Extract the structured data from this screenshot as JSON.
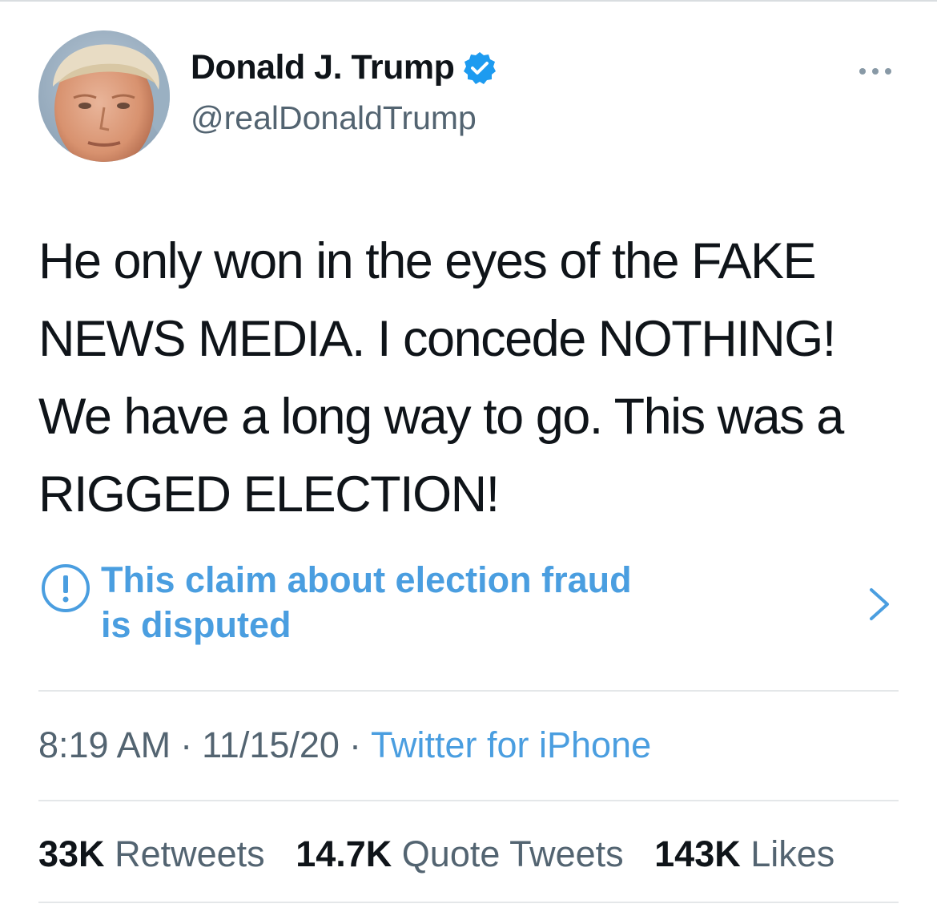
{
  "author": {
    "display_name": "Donald J. Trump",
    "handle": "@realDonaldTrump",
    "verified_icon": "verified-badge-icon",
    "avatar_icon": "profile-photo"
  },
  "tweet": {
    "text": "He only won in the eyes of the FAKE\nNEWS MEDIA. I concede NOTHING!\nWe have a long way to go. This was a\nRIGGED ELECTION!"
  },
  "notice": {
    "icon": "info-circle-icon",
    "text": "This claim about election fraud\nis disputed",
    "chevron_icon": "chevron-right-icon"
  },
  "meta": {
    "time": "8:19 AM",
    "separator": "·",
    "date": "11/15/20",
    "source": "Twitter for iPhone"
  },
  "stats": {
    "retweets_count": "33K",
    "retweets_label": "Retweets",
    "quotes_count": "14.7K",
    "quotes_label": "Quote Tweets",
    "likes_count": "143K",
    "likes_label": "Likes"
  },
  "colors": {
    "link_blue": "#4a9ee0",
    "verified_blue": "#1d9bf0",
    "secondary_text": "#536471",
    "primary_text": "#0f1419",
    "divider": "#e4e7e9"
  }
}
